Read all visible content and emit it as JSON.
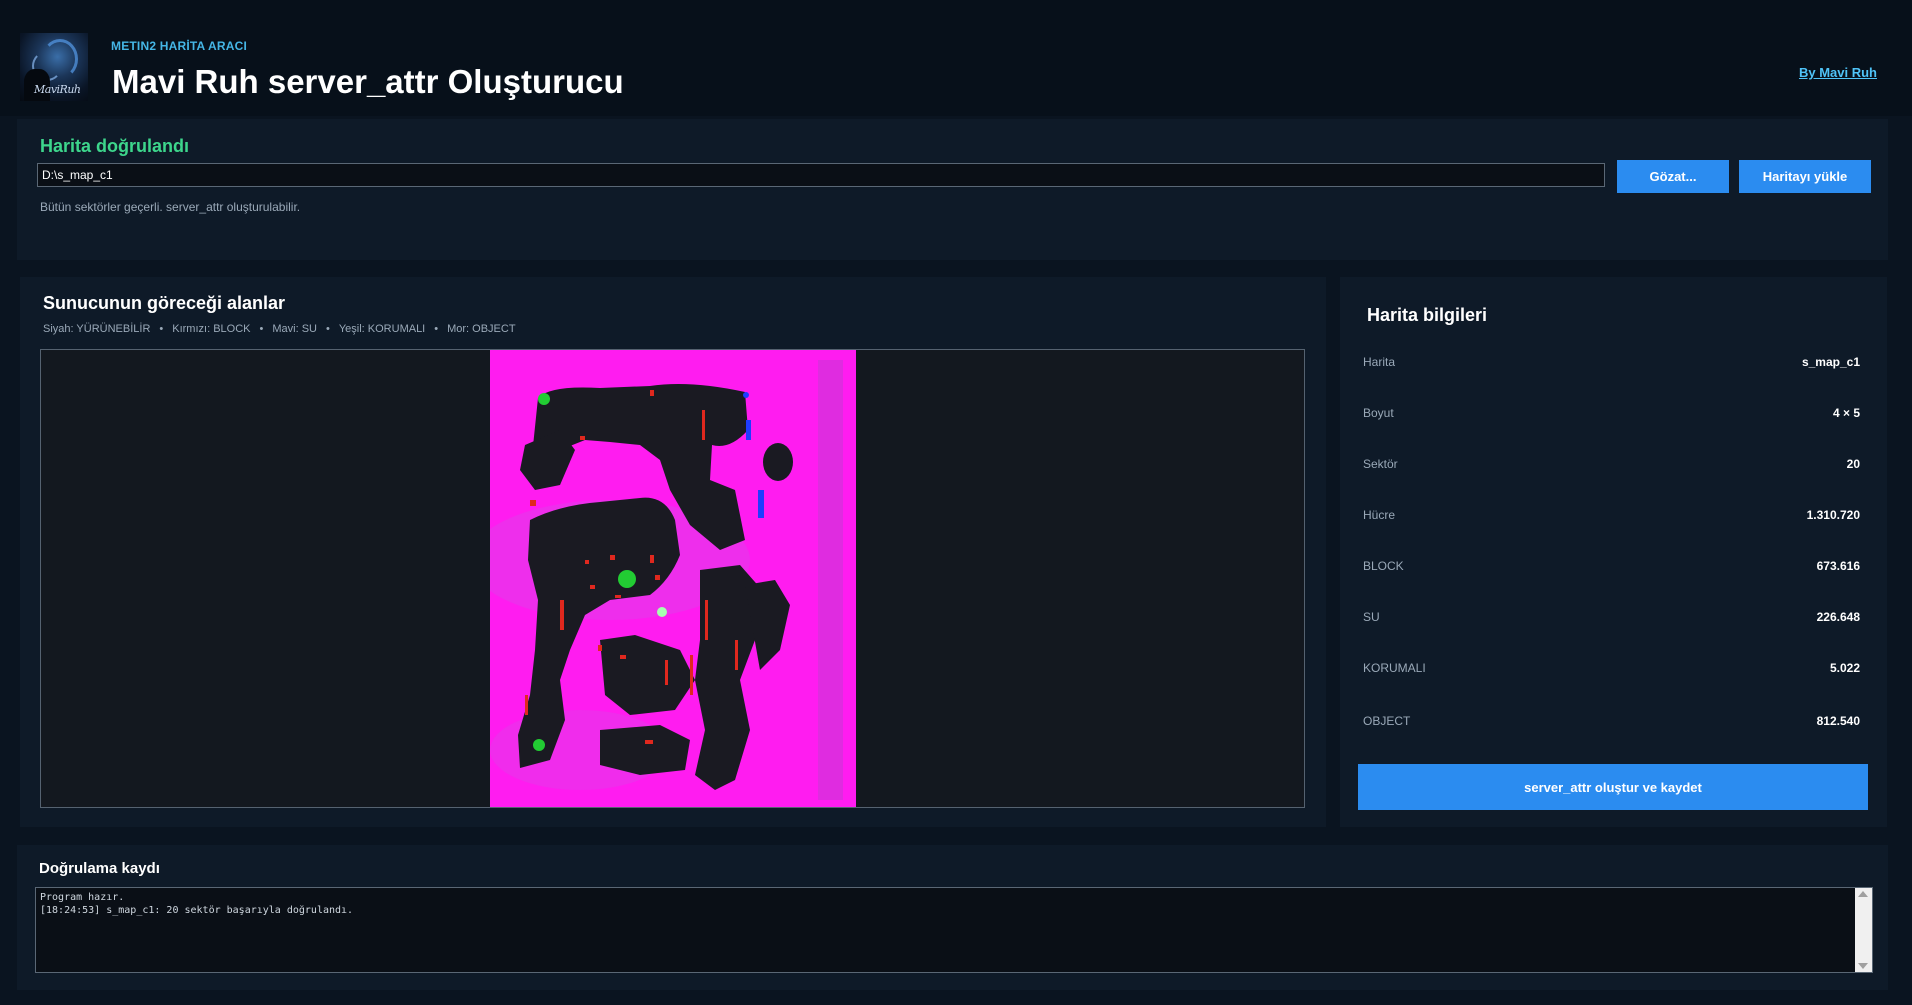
{
  "header": {
    "kicker": "METIN2 HARİTA ARACI",
    "title": "Mavi Ruh server_attr Oluşturucu",
    "by_link": "By Mavi Ruh",
    "logo_text": "MaviRuh"
  },
  "top_panel": {
    "status_title": "Harita doğrulandı",
    "path_value": "D:\\s_map_c1",
    "browse_label": "Gözat...",
    "load_label": "Haritayı yükle",
    "status_message": "Bütün sektörler geçerli. server_attr oluşturulabilir."
  },
  "map_panel": {
    "title": "Sunucunun göreceği alanlar",
    "legend": [
      "Siyah: YÜRÜNEBİLİR",
      "Kırmızı: BLOCK",
      "Mavi: SU",
      "Yeşil: KORUMALI",
      "Mor: OBJECT"
    ],
    "legend_separator": "•"
  },
  "info_panel": {
    "title": "Harita bilgileri",
    "rows": [
      {
        "key": "Harita",
        "value": "s_map_c1"
      },
      {
        "key": "Boyut",
        "value": "4 × 5"
      },
      {
        "key": "Sektör",
        "value": "20"
      },
      {
        "key": "Hücre",
        "value": "1.310.720"
      },
      {
        "key": "BLOCK",
        "value": "673.616"
      },
      {
        "key": "SU",
        "value": "226.648"
      },
      {
        "key": "KORUMALI",
        "value": "5.022"
      },
      {
        "key": "OBJECT",
        "value": "812.540"
      }
    ],
    "generate_label": "server_attr oluştur ve kaydet"
  },
  "log_panel": {
    "title": "Doğrulama kaydı",
    "lines": [
      "Program hazır.",
      "[18:24:53] s_map_c1: 20 sektör başarıyla doğrulandı."
    ]
  },
  "colors": {
    "background": "#0a1420",
    "panel": "#0e1a28",
    "accent_blue": "#2b8cf0",
    "success_green": "#3dd68c",
    "link": "#4fc3f7",
    "map_object": "#ff1cf0",
    "map_walkable": "#1a1a22",
    "map_block": "#e0281e",
    "map_water": "#1f3cff",
    "map_protected": "#22cc33"
  }
}
